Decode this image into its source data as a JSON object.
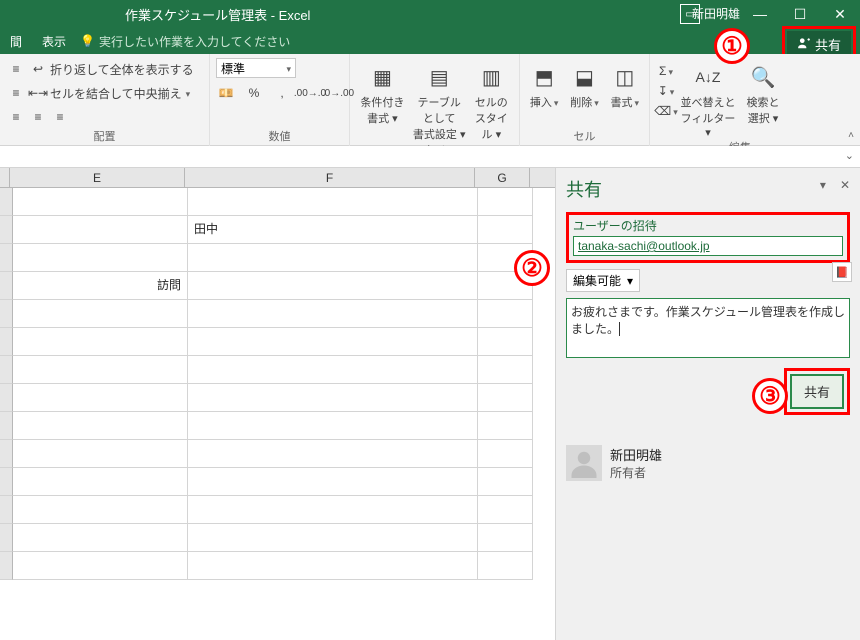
{
  "titlebar": {
    "title": "作業スケジュール管理表 - Excel",
    "user": "新田明雄"
  },
  "tabs": {
    "t1": "間",
    "t2": "表示",
    "tellme": "実行したい作業を入力してください",
    "share": "共有"
  },
  "ribbon": {
    "alignment": {
      "wrap": "折り返して全体を表示する",
      "merge": "セルを結合して中央揃え",
      "label": "配置"
    },
    "number": {
      "format": "標準",
      "label": "数値"
    },
    "styles": {
      "cond": "条件付き\n書式 ▾",
      "table": "テーブルとして\n書式設定 ▾",
      "cell": "セルの\nスタイル ▾",
      "label": "スタイル"
    },
    "cells": {
      "insert": "挿入",
      "delete": "削除",
      "format": "書式",
      "label": "セル"
    },
    "editing": {
      "sort": "並べ替えと\nフィルター ▾",
      "find": "検索と\n選択 ▾",
      "label": "編集"
    }
  },
  "columns": {
    "E": "E",
    "F": "F",
    "G": "G"
  },
  "cells": {
    "F2": "田中",
    "E4": "訪問"
  },
  "share_pane": {
    "title": "共有",
    "invite_label": "ユーザーの招待",
    "email": "tanaka-sachi@outlook.jp",
    "permission": "編集可能",
    "message": "お疲れさまです。作業スケジュール管理表を作成しました。",
    "submit": "共有",
    "owner_name": "新田明雄",
    "owner_role": "所有者"
  },
  "callouts": {
    "c1": "①",
    "c2": "②",
    "c3": "③"
  }
}
